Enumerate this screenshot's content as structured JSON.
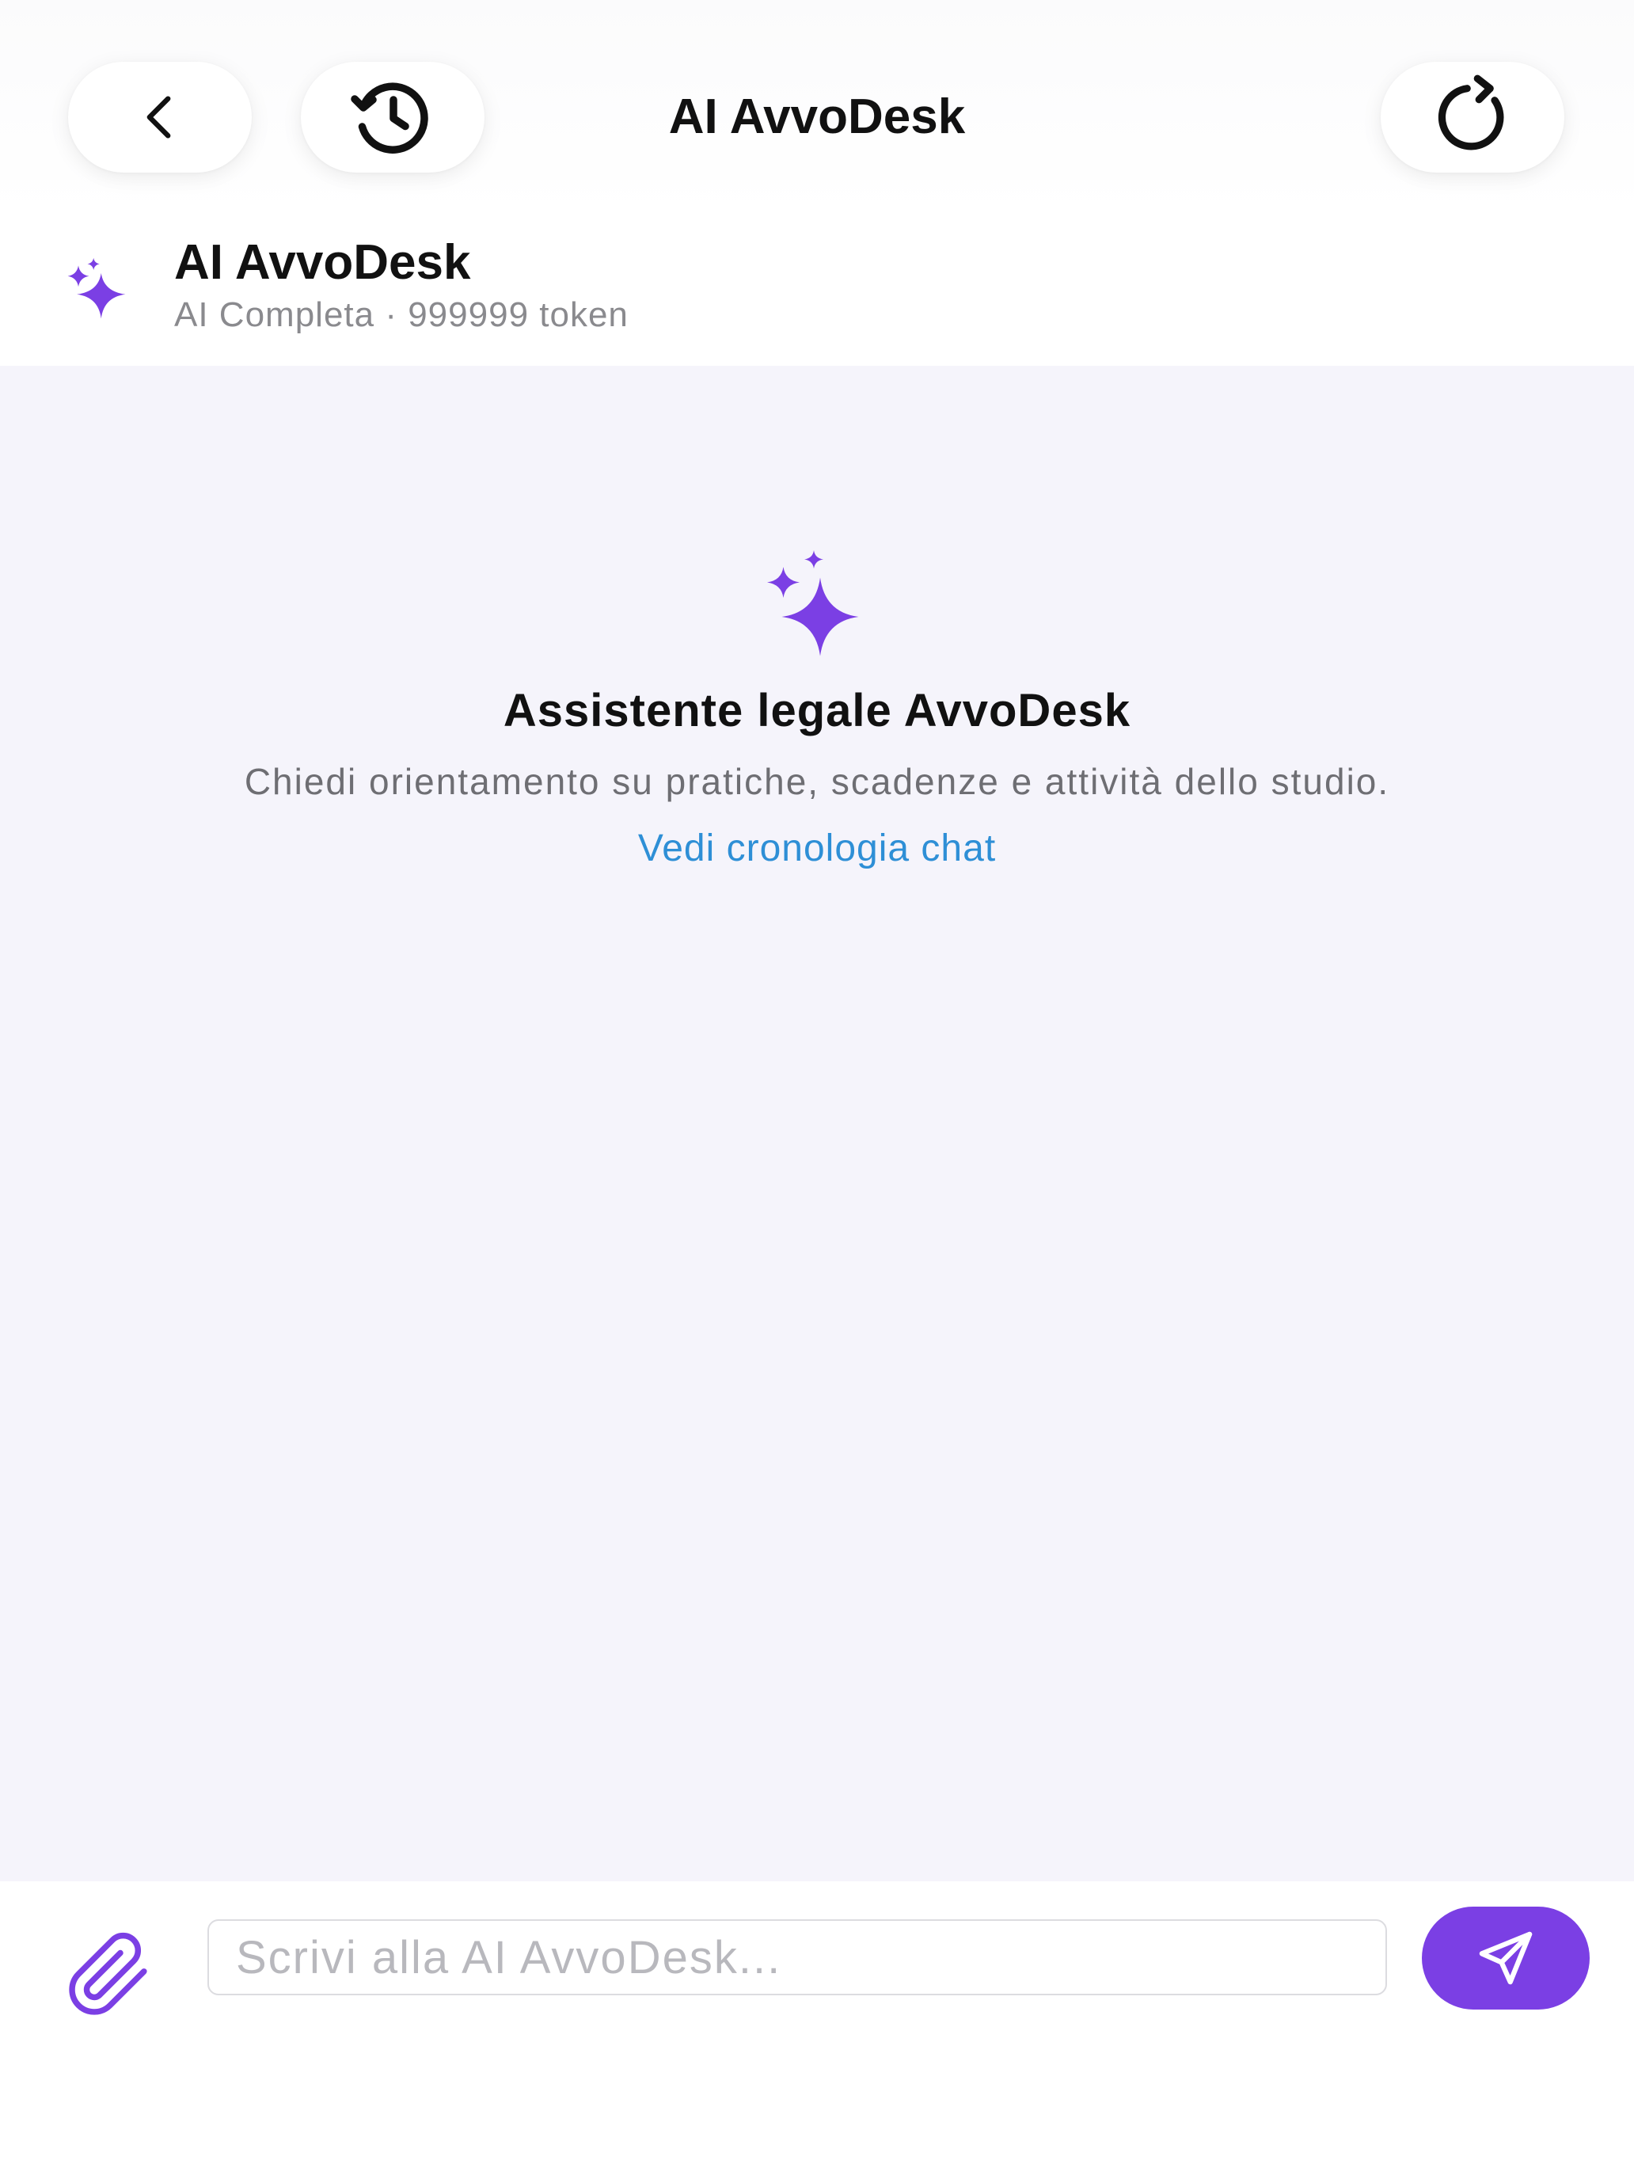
{
  "colors": {
    "accent": "#7b3fe4",
    "link": "#2e8fd6",
    "chat_background": "#f5f4fb",
    "text_primary": "#111111",
    "text_secondary": "#8a8a8e"
  },
  "nav": {
    "title": "AI AvvoDesk",
    "back_icon": "chevron-left-icon",
    "history_icon": "history-clock-icon",
    "refresh_icon": "refresh-icon"
  },
  "assistant": {
    "icon": "sparkles-icon",
    "name": "AI AvvoDesk",
    "subtitle": "AI Completa · 999999 token"
  },
  "empty_state": {
    "icon": "sparkles-icon",
    "title": "Assistente legale AvvoDesk",
    "description": "Chiedi orientamento su pratiche, scadenze e attività dello studio.",
    "history_link": "Vedi cronologia chat"
  },
  "composer": {
    "attach_icon": "paperclip-icon",
    "input_placeholder": "Scrivi alla AI AvvoDesk...",
    "input_value": "",
    "send_icon": "send-icon"
  }
}
